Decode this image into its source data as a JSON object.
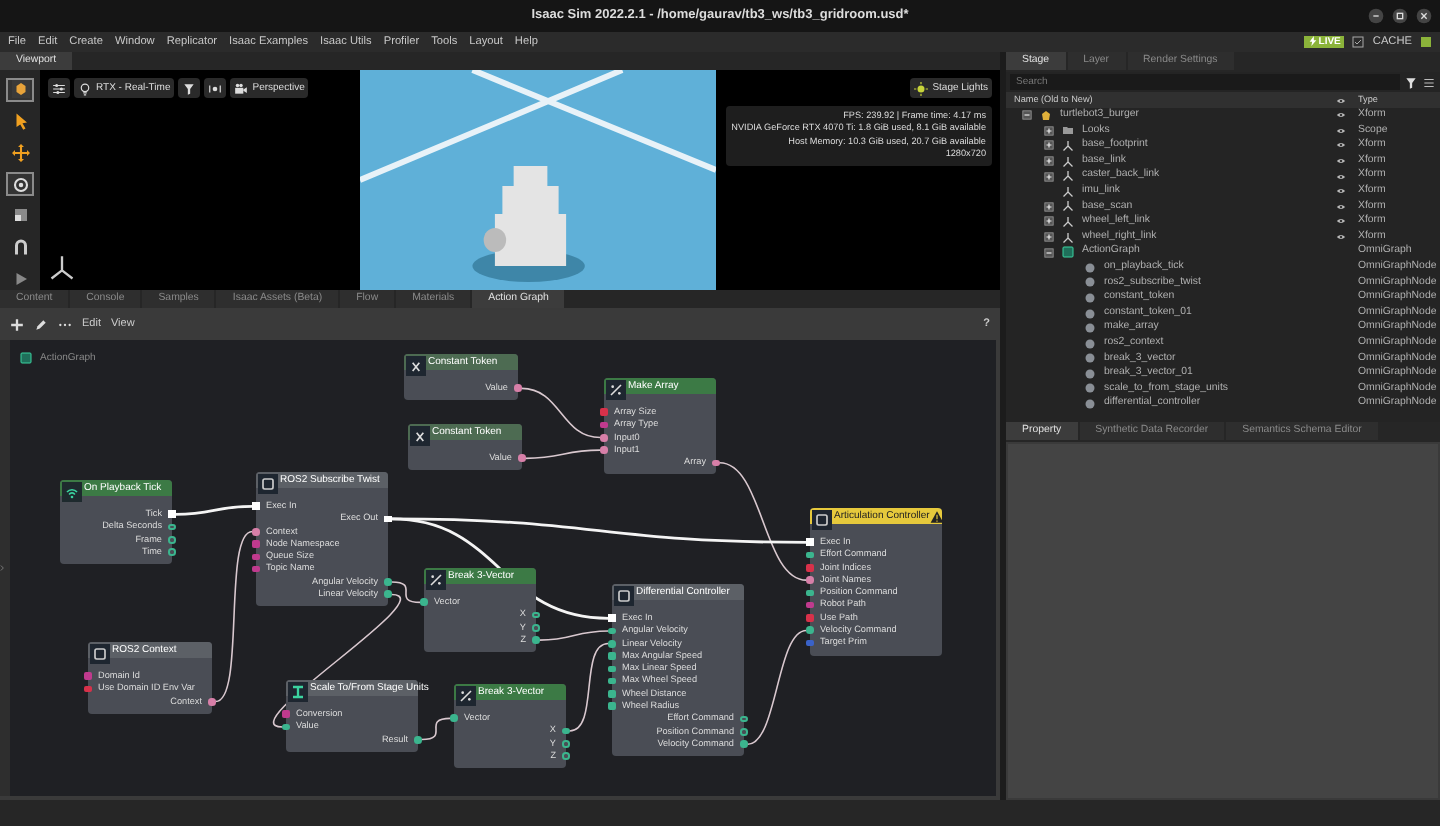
{
  "window": {
    "title": "Isaac Sim 2022.2.1 - /home/gaurav/tb3_ws/tb3_gridroom.usd*",
    "controls": [
      {
        "kind": "minimize"
      },
      {
        "kind": "maximize"
      },
      {
        "kind": "close"
      }
    ]
  },
  "menu": [
    "File",
    "Edit",
    "Create",
    "Window",
    "Replicator",
    "Isaac Examples",
    "Isaac Utils",
    "Profiler",
    "Tools",
    "Layout",
    "Help"
  ],
  "live": {
    "badge": "LIVE",
    "cache": "CACHE"
  },
  "viewport": {
    "tab": "Viewport",
    "tools": [
      {
        "kind": "logo",
        "selected": true
      },
      {
        "kind": "select",
        "selected": false
      },
      {
        "kind": "move",
        "selected": false
      },
      {
        "kind": "rotate",
        "selected": true
      },
      {
        "kind": "scale",
        "selected": false
      },
      {
        "kind": "snap",
        "selected": false
      },
      {
        "kind": "play",
        "selected": false
      }
    ],
    "toolbar": [
      {
        "kind": "settings"
      },
      {
        "kind": "bulb",
        "label": "RTX - Real-Time"
      },
      {
        "kind": "filter"
      },
      {
        "kind": "capture"
      },
      {
        "kind": "camera",
        "label": "Perspective"
      }
    ],
    "stage_lights": "Stage Lights",
    "stats": [
      "FPS: 239.92 | Frame time: 4.17 ms",
      "NVIDIA GeForce RTX 4070 Ti: 1.8 GiB used, 8.1 GiB available",
      "Host Memory: 10.3 GiB used, 20.7 GiB available",
      "1280x720"
    ]
  },
  "bottom_tabs": [
    {
      "label": "Content",
      "selected": false
    },
    {
      "label": "Console",
      "selected": false
    },
    {
      "label": "Samples",
      "selected": false
    },
    {
      "label": "Isaac Assets (Beta)",
      "selected": false
    },
    {
      "label": "Flow",
      "selected": false
    },
    {
      "label": "Materials",
      "selected": false
    },
    {
      "label": "Action Graph",
      "selected": true
    }
  ],
  "graph": {
    "toolbar": [
      {
        "kind": "add"
      },
      {
        "kind": "pencil"
      },
      {
        "kind": "dots"
      }
    ],
    "menus": [
      "Edit",
      "View"
    ],
    "help": "?",
    "group": "ActionGraph",
    "nodes": [
      {
        "title": "On Playback Tick",
        "color": "#3c7a45",
        "kind": "event",
        "warning": false,
        "ports": [
          {
            "label": "Tick",
            "kind": "exec_out",
            "connected": true
          },
          {
            "label": "Delta Seconds",
            "kind": "data_out",
            "color": "#3bb58e",
            "connected": false
          },
          {
            "label": "Frame",
            "kind": "data_out",
            "color": "#3bb58e",
            "connected": false
          },
          {
            "label": "Time",
            "kind": "data_out",
            "color": "#3bb58e",
            "connected": false
          }
        ]
      },
      {
        "title": "ROS2 Subscribe Twist",
        "color": "#5c6066",
        "kind": "ros",
        "warning": false,
        "ports": [
          {
            "label": "Exec In",
            "kind": "exec_in",
            "connected": true
          },
          {
            "label": "Exec Out",
            "kind": "exec_out",
            "connected": true
          },
          {
            "label": "Context",
            "kind": "data_in",
            "color": "#d77fa8",
            "connected": true
          },
          {
            "label": "Node Namespace",
            "kind": "data_in",
            "color": "#c03a8e",
            "connected": false
          },
          {
            "label": "Queue Size",
            "kind": "data_in",
            "color": "#c03a8e",
            "connected": false
          },
          {
            "label": "Topic Name",
            "kind": "data_in",
            "color": "#c03a8e",
            "connected": false
          },
          {
            "label": "Angular Velocity",
            "kind": "data_out",
            "color": "#3bb58e",
            "connected": true
          },
          {
            "label": "Linear Velocity",
            "kind": "data_out",
            "color": "#3bb58e",
            "connected": true
          }
        ]
      },
      {
        "title": "Constant Token",
        "color": "#4d6b52",
        "kind": "constant",
        "warning": false,
        "ports": [
          {
            "label": "Value",
            "kind": "data_out",
            "color": "#d77fa8",
            "connected": true
          }
        ]
      },
      {
        "title": "Constant Token",
        "color": "#4d6b52",
        "kind": "constant",
        "warning": false,
        "ports": [
          {
            "label": "Value",
            "kind": "data_out",
            "color": "#d77fa8",
            "connected": true
          }
        ]
      },
      {
        "title": "Make Array",
        "color": "#3c7a45",
        "kind": "math",
        "warning": false,
        "ports": [
          {
            "label": "Array Size",
            "kind": "data_in",
            "color": "#d8314a",
            "connected": false
          },
          {
            "label": "Array Type",
            "kind": "data_in",
            "color": "#c03a8e",
            "connected": false
          },
          {
            "label": "Input0",
            "kind": "data_in",
            "color": "#d77fa8",
            "connected": true
          },
          {
            "label": "Input1",
            "kind": "data_in",
            "color": "#d77fa8",
            "connected": true
          },
          {
            "label": "Array",
            "kind": "data_out",
            "color": "#d77fa8",
            "connected": true
          }
        ]
      },
      {
        "title": "Break 3-Vector",
        "color": "#3c7a45",
        "kind": "math",
        "warning": false,
        "ports": [
          {
            "label": "Vector",
            "kind": "data_in",
            "color": "#3bb58e",
            "connected": true
          },
          {
            "label": "X",
            "kind": "data_out",
            "color": "#3bb58e",
            "connected": false
          },
          {
            "label": "Y",
            "kind": "data_out",
            "color": "#3bb58e",
            "connected": false
          },
          {
            "label": "Z",
            "kind": "data_out",
            "color": "#3bb58e",
            "connected": true
          }
        ]
      },
      {
        "title": "ROS2 Context",
        "color": "#5c6066",
        "kind": "ros",
        "warning": false,
        "ports": [
          {
            "label": "Domain Id",
            "kind": "data_in",
            "color": "#c03a8e",
            "connected": false
          },
          {
            "label": "Use Domain ID Env Var",
            "kind": "data_in",
            "color": "#d8314a",
            "connected": false
          },
          {
            "label": "Context",
            "kind": "data_out",
            "color": "#d77fa8",
            "connected": true
          }
        ]
      },
      {
        "title": "Scale To/From Stage Units",
        "color": "#5c6066",
        "kind": "scale",
        "warning": false,
        "ports": [
          {
            "label": "Conversion",
            "kind": "data_in",
            "color": "#c03a8e",
            "connected": false
          },
          {
            "label": "Value",
            "kind": "data_in",
            "color": "#3bb58e",
            "connected": true
          },
          {
            "label": "Result",
            "kind": "data_out",
            "color": "#3bb58e",
            "connected": true
          }
        ]
      },
      {
        "title": "Break 3-Vector",
        "color": "#3c7a45",
        "kind": "math",
        "warning": false,
        "ports": [
          {
            "label": "Vector",
            "kind": "data_in",
            "color": "#3bb58e",
            "connected": true
          },
          {
            "label": "X",
            "kind": "data_out",
            "color": "#3bb58e",
            "connected": true
          },
          {
            "label": "Y",
            "kind": "data_out",
            "color": "#3bb58e",
            "connected": false
          },
          {
            "label": "Z",
            "kind": "data_out",
            "color": "#3bb58e",
            "connected": false
          }
        ]
      },
      {
        "title": "Differential Controller",
        "color": "#5c6066",
        "kind": "ros",
        "warning": false,
        "ports": [
          {
            "label": "Exec In",
            "kind": "exec_in",
            "connected": true
          },
          {
            "label": "Angular Velocity",
            "kind": "data_in",
            "color": "#3bb58e",
            "connected": true
          },
          {
            "label": "Linear Velocity",
            "kind": "data_in",
            "color": "#3bb58e",
            "connected": true
          },
          {
            "label": "Max Angular Speed",
            "kind": "data_in",
            "color": "#3bb58e",
            "connected": false
          },
          {
            "label": "Max Linear Speed",
            "kind": "data_in",
            "color": "#3bb58e",
            "connected": false
          },
          {
            "label": "Max Wheel Speed",
            "kind": "data_in",
            "color": "#3bb58e",
            "connected": false
          },
          {
            "label": "Wheel Distance",
            "kind": "data_in",
            "color": "#3bb58e",
            "connected": false
          },
          {
            "label": "Wheel Radius",
            "kind": "data_in",
            "color": "#3bb58e",
            "connected": false
          },
          {
            "label": "Effort Command",
            "kind": "data_out",
            "color": "#3bb58e",
            "connected": false
          },
          {
            "label": "Position Command",
            "kind": "data_out",
            "color": "#3bb58e",
            "connected": false
          },
          {
            "label": "Velocity Command",
            "kind": "data_out",
            "color": "#3bb58e",
            "connected": true
          }
        ]
      },
      {
        "title": "Articulation Controller",
        "color": "#e6c93c",
        "kind": "ros",
        "warning": true,
        "ports": [
          {
            "label": "Exec In",
            "kind": "exec_in",
            "connected": true
          },
          {
            "label": "Effort Command",
            "kind": "data_in",
            "color": "#3bb58e",
            "connected": false
          },
          {
            "label": "Joint Indices",
            "kind": "data_in",
            "color": "#d8314a",
            "connected": false
          },
          {
            "label": "Joint Names",
            "kind": "data_in",
            "color": "#d77fa8",
            "connected": true
          },
          {
            "label": "Position Command",
            "kind": "data_in",
            "color": "#3bb58e",
            "connected": false
          },
          {
            "label": "Robot Path",
            "kind": "data_in",
            "color": "#c03a8e",
            "connected": false
          },
          {
            "label": "Use Path",
            "kind": "data_in",
            "color": "#d8314a",
            "connected": false
          },
          {
            "label": "Velocity Command",
            "kind": "data_in",
            "color": "#3bb58e",
            "connected": true
          },
          {
            "label": "Target Prim",
            "kind": "data_in",
            "color": "#3a62c8",
            "connected": false
          }
        ]
      }
    ]
  },
  "stage": {
    "tabs": [
      {
        "label": "Stage",
        "selected": true
      },
      {
        "label": "Layer",
        "selected": false
      },
      {
        "label": "Render Settings",
        "selected": false
      }
    ],
    "search": {
      "placeholder": "Search"
    },
    "columns": [
      "Name (Old to New)",
      "Type"
    ],
    "tree": [
      {
        "name": "turtlebot3_burger",
        "type": "Xform",
        "kind": "robot",
        "visible": true,
        "expanded": true,
        "children": [
          {
            "name": "Looks",
            "type": "Scope",
            "kind": "folder",
            "visible": true,
            "expanded": false
          },
          {
            "name": "base_footprint",
            "type": "Xform",
            "kind": "xform",
            "visible": true,
            "expanded": false
          },
          {
            "name": "base_link",
            "type": "Xform",
            "kind": "xform",
            "visible": true,
            "expanded": false
          },
          {
            "name": "caster_back_link",
            "type": "Xform",
            "kind": "xform",
            "visible": true,
            "expanded": false
          },
          {
            "name": "imu_link",
            "type": "Xform",
            "kind": "xform",
            "visible": true
          },
          {
            "name": "base_scan",
            "type": "Xform",
            "kind": "xform",
            "visible": true,
            "expanded": false
          },
          {
            "name": "wheel_left_link",
            "type": "Xform",
            "kind": "xform",
            "visible": true,
            "expanded": false
          },
          {
            "name": "wheel_right_link",
            "type": "Xform",
            "kind": "xform",
            "visible": true,
            "expanded": false
          },
          {
            "name": "ActionGraph",
            "type": "OmniGraph",
            "kind": "graph",
            "visible": false,
            "expanded": true,
            "children": [
              {
                "name": "on_playback_tick",
                "type": "OmniGraphNode",
                "kind": "node",
                "visible": false
              },
              {
                "name": "ros2_subscribe_twist",
                "type": "OmniGraphNode",
                "kind": "node",
                "visible": false
              },
              {
                "name": "constant_token",
                "type": "OmniGraphNode",
                "kind": "node",
                "visible": false
              },
              {
                "name": "constant_token_01",
                "type": "OmniGraphNode",
                "kind": "node",
                "visible": false
              },
              {
                "name": "make_array",
                "type": "OmniGraphNode",
                "kind": "node",
                "visible": false
              },
              {
                "name": "ros2_context",
                "type": "OmniGraphNode",
                "kind": "node",
                "visible": false
              },
              {
                "name": "break_3_vector",
                "type": "OmniGraphNode",
                "kind": "node",
                "visible": false
              },
              {
                "name": "break_3_vector_01",
                "type": "OmniGraphNode",
                "kind": "node",
                "visible": false
              },
              {
                "name": "scale_to_from_stage_units",
                "type": "OmniGraphNode",
                "kind": "node",
                "visible": false
              },
              {
                "name": "differential_controller",
                "type": "OmniGraphNode",
                "kind": "node",
                "visible": false
              }
            ]
          }
        ]
      }
    ]
  },
  "property_tabs": [
    {
      "label": "Property",
      "selected": true
    },
    {
      "label": "Synthetic Data Recorder",
      "selected": false
    },
    {
      "label": "Semantics Schema Editor",
      "selected": false
    }
  ]
}
